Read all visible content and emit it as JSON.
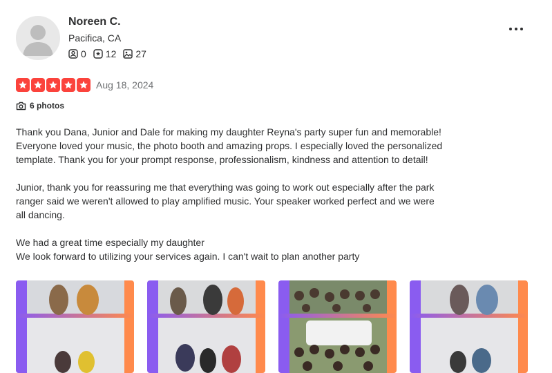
{
  "user": {
    "name": "Noreen C.",
    "location": "Pacifica, CA",
    "friends_count": "0",
    "reviews_count": "12",
    "photos_count": "27",
    "avatar_icon": "avatar-placeholder-icon"
  },
  "menu": {
    "icon": "more-options-icon"
  },
  "rating": {
    "stars": 5,
    "max": 5,
    "color": "#fb433c",
    "date": "Aug 18, 2024"
  },
  "photos_link": {
    "icon": "camera-icon",
    "label": "6 photos"
  },
  "review": {
    "paragraphs": [
      "Thank you Dana, Junior and Dale for making my daughter Reyna's party super fun and memorable!\nEveryone loved your music, the photo booth and amazing props. I especially loved the personalized\ntemplate. Thank you for your prompt response, professionalism, kindness and attention to detail!",
      "Junior, thank you for reassuring me that everything was going to work out especially after the park\nranger said we weren't allowed to play amplified music. Your speaker worked perfect and we were\nall dancing.",
      "We had a great time especially my daughter\nWe look forward to utilizing your services again. I can't wait to plan another party"
    ]
  },
  "thumbnails": [
    {
      "name": "photo-thumbnail-1"
    },
    {
      "name": "photo-thumbnail-2"
    },
    {
      "name": "photo-thumbnail-3"
    },
    {
      "name": "photo-thumbnail-4"
    }
  ],
  "colors": {
    "accent_purple": "#8a5cf0",
    "accent_orange": "#ff8a4c"
  }
}
